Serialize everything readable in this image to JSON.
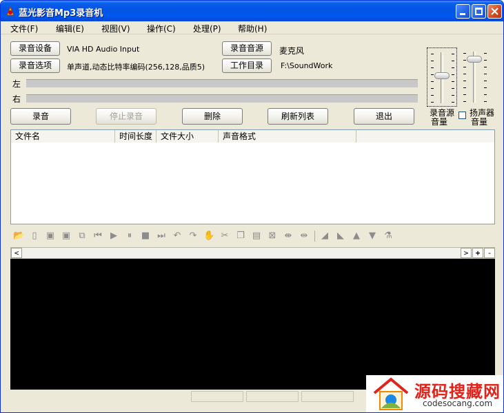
{
  "window": {
    "title": "蓝光影音Mp3录音机"
  },
  "menu": [
    "文件(F)",
    "编辑(E)",
    "视图(V)",
    "操作(C)",
    "处理(P)",
    "帮助(H)"
  ],
  "device": {
    "record_device_button": "录音设备",
    "record_device_value": "VIA HD Audio Input",
    "record_option_button": "录音选项",
    "record_option_value": "单声道,动态比特率编码(256,128,品质5)",
    "record_source_button": "录音音源",
    "record_source_value": "麦克风",
    "work_dir_button": "工作目录",
    "work_dir_value": "F:\\SoundWork"
  },
  "levels": {
    "left_label": "左",
    "right_label": "右"
  },
  "actions": {
    "record": "录音",
    "stop": "停止录音",
    "delete": "删除",
    "refresh": "刷新列表",
    "exit": "退出"
  },
  "volume": {
    "record_label_1": "录音源",
    "record_label_2": "音量",
    "speaker_label_1": "扬声器",
    "speaker_label_2": "音量",
    "record_level": 0.55,
    "speaker_level": 0.9
  },
  "file_list": {
    "columns": [
      "文件名",
      "时间长度",
      "文件大小",
      "声音格式"
    ],
    "rows": []
  },
  "toolbar": {
    "icons": [
      "open-folder-icon",
      "close-file-icon",
      "save-icon",
      "save-as-icon",
      "export-icon",
      "skip-back-icon",
      "play-icon",
      "pause-icon",
      "stop-icon",
      "skip-forward-icon",
      "undo-icon",
      "redo-icon",
      "hand-icon",
      "cut-icon",
      "copy-icon",
      "paste-icon",
      "mix-icon",
      "trim-icon",
      "extend-icon",
      "fade-in-icon",
      "fade-out-icon",
      "volume-up-icon",
      "volume-down-icon",
      "effects-icon"
    ]
  },
  "wave": {
    "scroll_left": "<",
    "scroll_right": ">",
    "zoom_in": "+",
    "zoom_out": "-"
  },
  "watermark": {
    "cn": "源码搜藏网",
    "en": "codesocang.com"
  }
}
